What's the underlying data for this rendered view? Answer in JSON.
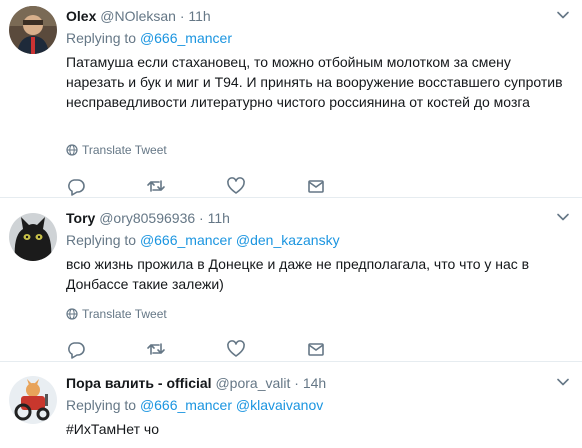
{
  "tweets": [
    {
      "name": "Olex",
      "handle": "@NOleksan",
      "separator": "·",
      "time": "11h",
      "replying_prefix": "Replying to",
      "replying_to": [
        "@666_mancer"
      ],
      "text": "Патамуша если стахановец, то  можно отбойным молотком за смену нарезать и бук и миг и Т94. И принять на вооружение восставшего супротив несправедливости литературно чистого россиянина от  костей до мозга",
      "translate_label": "Translate Tweet"
    },
    {
      "name": "Tory",
      "handle": "@ory80596936",
      "separator": "·",
      "time": "11h",
      "replying_prefix": "Replying to",
      "replying_to": [
        "@666_mancer",
        "@den_kazansky"
      ],
      "text": "всю жизнь прожила в Донецке  и даже не предполагала, что что у нас в Донбассе такие залежи)",
      "translate_label": "Translate Tweet"
    },
    {
      "name": "Пора валить - official",
      "handle": "@pora_valit",
      "separator": "·",
      "time": "14h",
      "replying_prefix": "Replying to",
      "replying_to": [
        "@666_mancer",
        "@klavaivanov"
      ],
      "text": "#ИхТамНет чо"
    }
  ],
  "colors": {
    "link": "#1b95e0",
    "secondary": "#657786",
    "divider": "#e6ecf0"
  },
  "icons": [
    "chevron-down-icon",
    "globe-icon",
    "reply-icon",
    "retweet-icon",
    "like-icon",
    "message-icon"
  ]
}
